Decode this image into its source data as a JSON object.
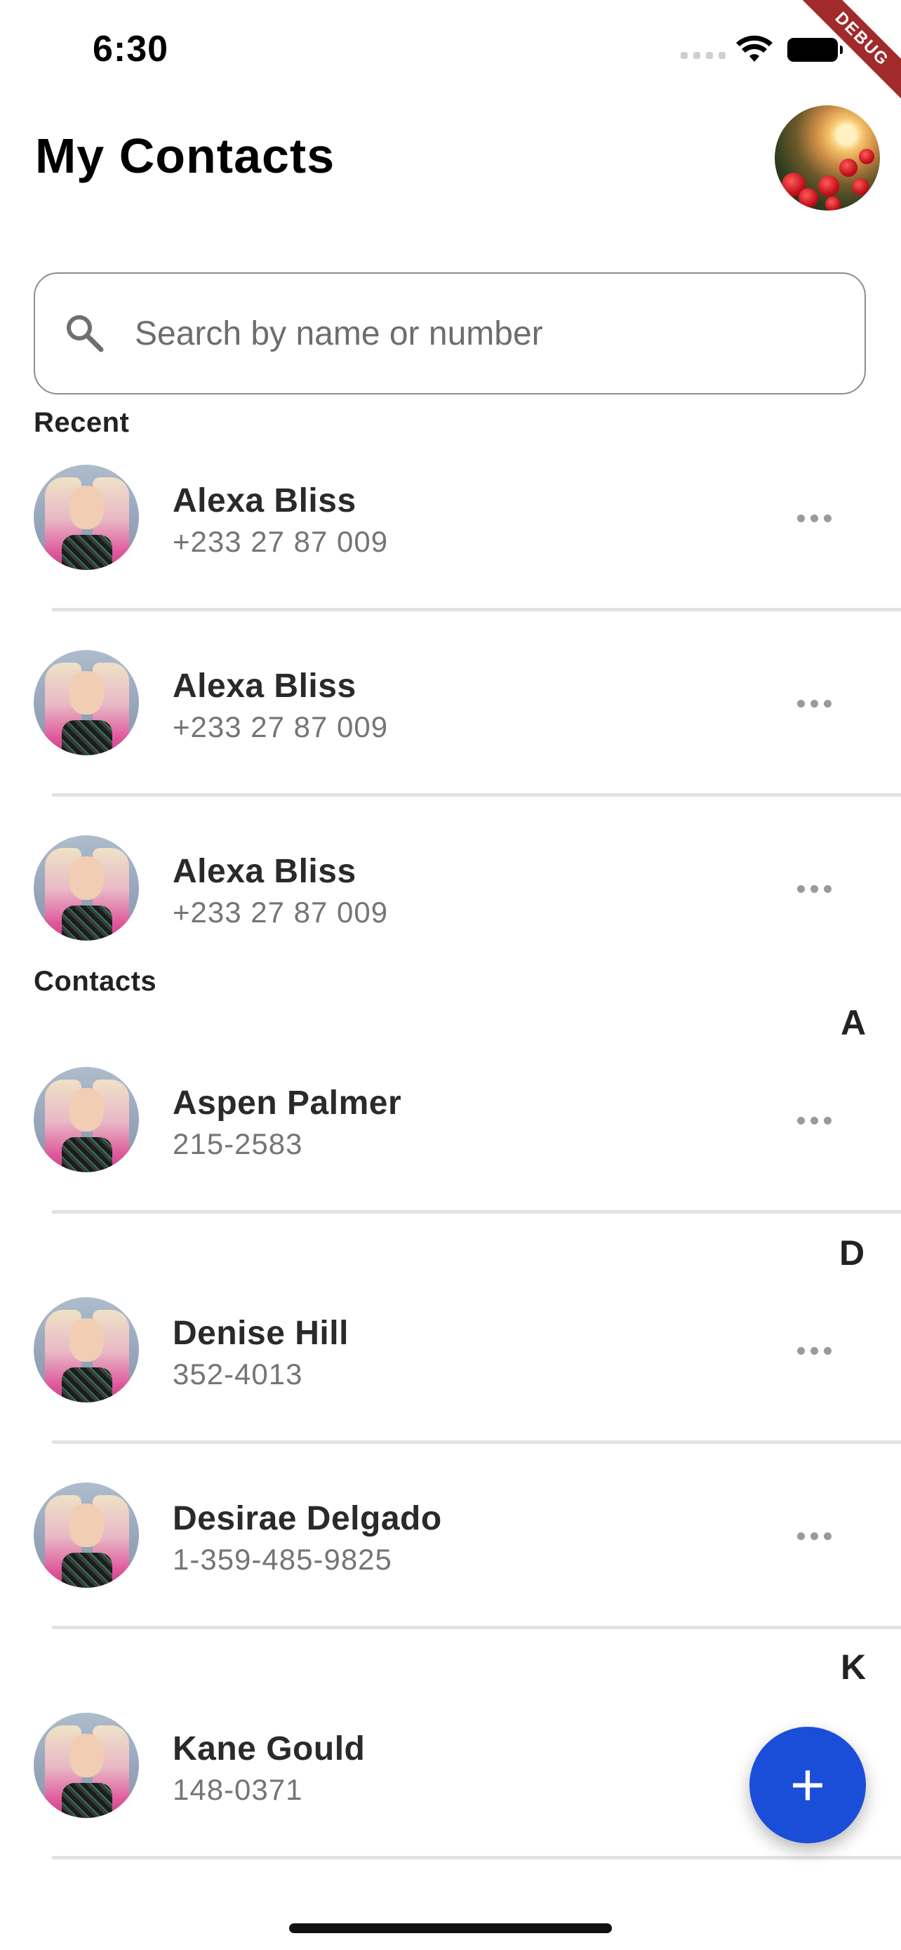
{
  "status_bar": {
    "time": "6:30"
  },
  "debug_banner": "DEBUG",
  "header": {
    "title": "My Contacts"
  },
  "search": {
    "placeholder": "Search by name or number"
  },
  "sections": {
    "recent": "Recent",
    "contacts": "Contacts"
  },
  "recent": [
    {
      "name": "Alexa Bliss",
      "phone": "+233 27 87 009"
    },
    {
      "name": "Alexa Bliss",
      "phone": "+233 27 87 009"
    },
    {
      "name": "Alexa Bliss",
      "phone": "+233 27 87 009"
    }
  ],
  "letters": {
    "a": "A",
    "d": "D",
    "k": "K"
  },
  "contacts": [
    {
      "name": "Aspen Palmer",
      "phone": "215-2583"
    },
    {
      "name": "Denise Hill",
      "phone": "352-4013"
    },
    {
      "name": "Desirae Delgado",
      "phone": "1-359-485-9825"
    },
    {
      "name": "Kane Gould",
      "phone": "148-0371"
    }
  ],
  "fab": {
    "label": "+"
  },
  "colors": {
    "accent": "#1b4ed8",
    "divider": "#e2e2e2",
    "debug_ribbon": "#a12a2a"
  }
}
